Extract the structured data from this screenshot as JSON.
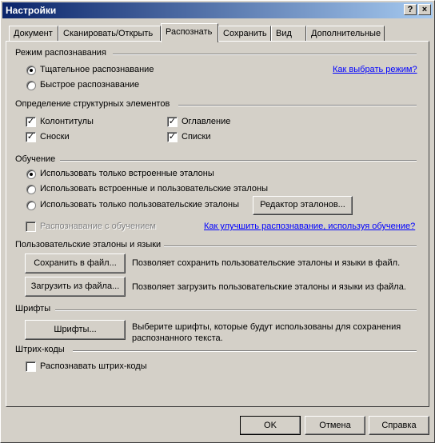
{
  "window": {
    "title": "Настройки",
    "help_btn": "?",
    "close_btn": "×"
  },
  "tabs": [
    {
      "label": "Документ",
      "active": false
    },
    {
      "label": "Сканировать/Открыть",
      "active": false
    },
    {
      "label": "Распознать",
      "active": true
    },
    {
      "label": "Сохранить",
      "active": false
    },
    {
      "label": "Вид",
      "active": false
    },
    {
      "label": "Дополнительные",
      "active": false
    }
  ],
  "mode": {
    "title": "Режим распознавания",
    "thorough": "Тщательное распознавание",
    "fast": "Быстрое распознавание",
    "selected": "thorough",
    "link": "Как выбрать режим?"
  },
  "structure": {
    "title": "Определение структурных элементов",
    "headers": "Колонтитулы",
    "toc": "Оглавление",
    "footnotes": "Сноски",
    "lists": "Списки",
    "checked_mark": "✓"
  },
  "training": {
    "title": "Обучение",
    "builtin_only": "Использовать только встроенные эталоны",
    "builtin_and_user": "Использовать встроенные и пользовательские эталоны",
    "user_only": "Использовать только пользовательские эталоны",
    "selected": "builtin_only",
    "editor_button": "Редактор эталонов...",
    "recognition_with_training": "Распознавание с обучением",
    "link": "Как улучшить распознавание, используя обучение?"
  },
  "user_patterns": {
    "title": "Пользовательские эталоны и языки",
    "save_button": "Сохранить в файл...",
    "save_desc": "Позволяет сохранить пользовательские эталоны и языки в файл.",
    "load_button": "Загрузить из файла...",
    "load_desc": "Позволяет загрузить пользовательские эталоны и языки из файла."
  },
  "fonts": {
    "title": "Шрифты",
    "button": "Шрифты...",
    "desc_line1": "Выберите шрифты, которые будут использованы для сохранения",
    "desc_line2": "распознанного текста."
  },
  "barcodes": {
    "title": "Штрих-коды",
    "checkbox": "Распознавать штрих-коды",
    "checked": false
  },
  "footer": {
    "ok": "OK",
    "cancel": "Отмена",
    "help": "Справка"
  },
  "colors": {
    "face": "#d4d0c8",
    "title_start": "#0a246a",
    "title_end": "#a6caf0",
    "link": "#0000ff",
    "disabled_text": "#808080"
  }
}
